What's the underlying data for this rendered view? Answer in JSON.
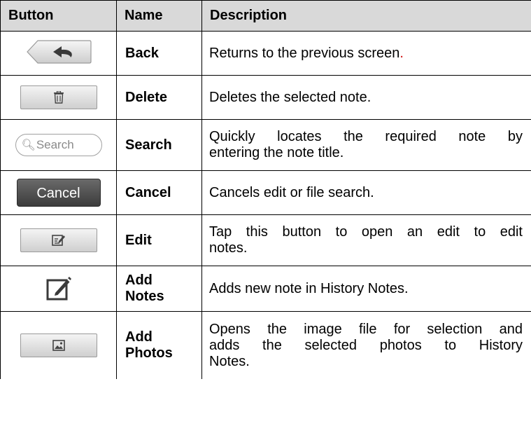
{
  "header": {
    "col_button": "Button",
    "col_name": "Name",
    "col_description": "Description"
  },
  "rows": [
    {
      "icon": "back-arrow-icon",
      "name": "Back",
      "desc_main": "Returns to the previous screen",
      "desc_tail": "."
    },
    {
      "icon": "trash-icon",
      "name": "Delete",
      "desc": "Deletes the selected note."
    },
    {
      "icon": "search-icon",
      "button_text": "Search",
      "name": "Search",
      "desc_line1": "Quickly locates the required note by",
      "desc_line2": "entering the note title."
    },
    {
      "icon": "cancel-button",
      "button_text": "Cancel",
      "name": "Cancel",
      "desc": "Cancels edit or file search."
    },
    {
      "icon": "edit-icon",
      "name": "Edit",
      "desc_line1": "Tap this button to open an edit to edit",
      "desc_line2": "notes."
    },
    {
      "icon": "add-notes-icon",
      "name_line1": "Add",
      "name_line2": "Notes",
      "desc": "Adds new note in History Notes."
    },
    {
      "icon": "photo-icon",
      "name_line1": "Add",
      "name_line2": "Photos",
      "desc_line1": "Opens the image file for selection and",
      "desc_line2": "adds the selected photos to History",
      "desc_line3": "Notes."
    }
  ],
  "colors": {
    "header_bg": "#d9d9d9",
    "accent_red": "#d01010"
  }
}
